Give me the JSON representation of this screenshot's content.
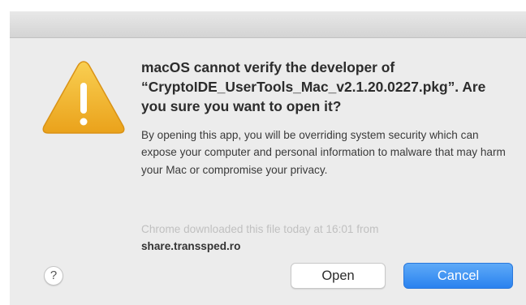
{
  "dialog": {
    "heading": "macOS cannot verify the developer of “CryptoIDE_UserTools_Mac_v2.1.20.0227.pkg”. Are you sure you want to open it?",
    "message": "By opening this app, you will be overriding system security which can expose your computer and personal information to malware that may harm your Mac or compromise your privacy.",
    "source_text": "Chrome downloaded this file today at 16:01 from",
    "source_host": "share.transsped.ro",
    "icon": "warning-triangle-icon",
    "help_label": "?",
    "open_label": "Open",
    "cancel_label": "Cancel",
    "colors": {
      "warning": "#f0b429",
      "default_button": "#2a82ef"
    }
  }
}
